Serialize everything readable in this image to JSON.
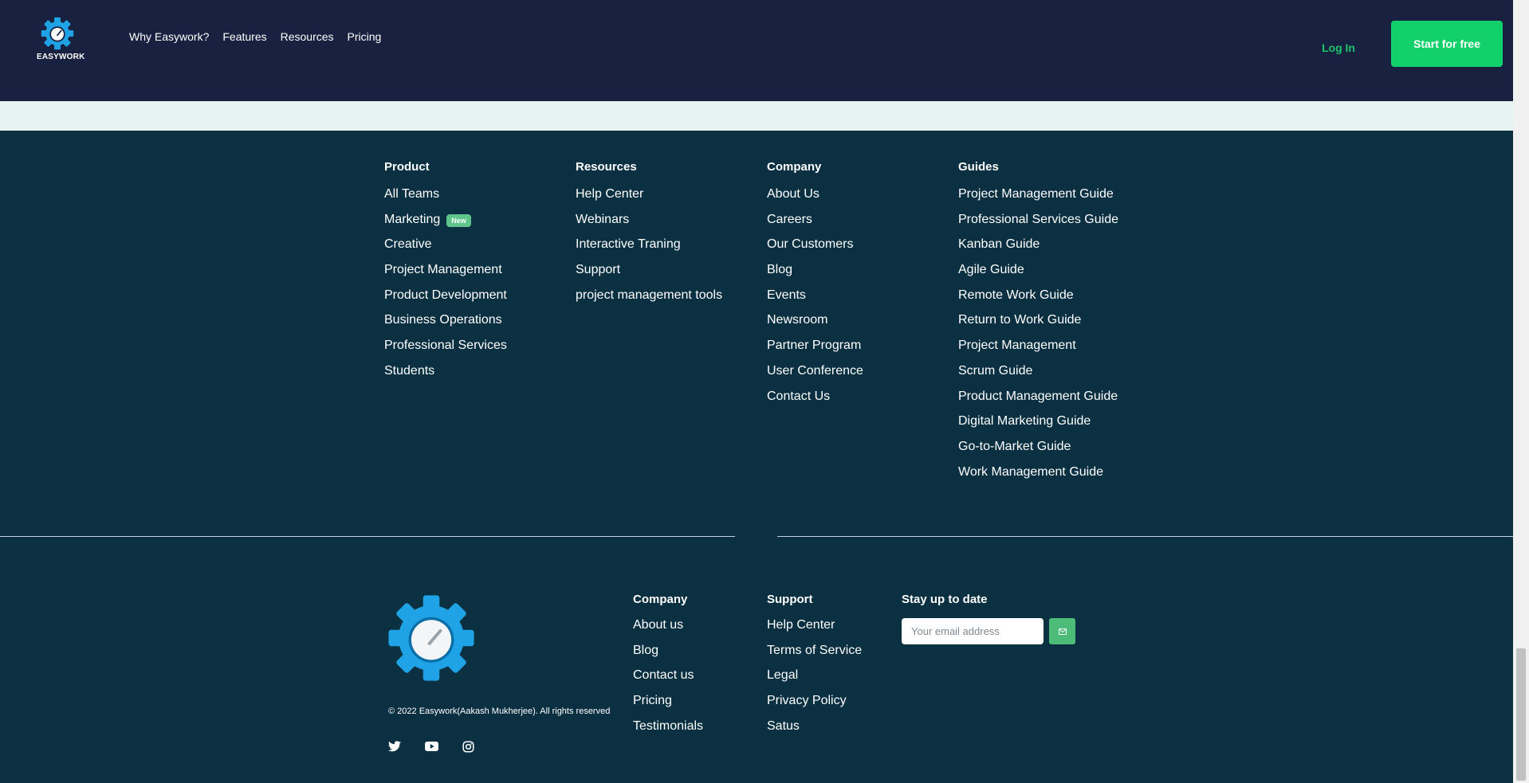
{
  "nav": {
    "brand": "EASYWORK",
    "links": [
      "Why Easywork?",
      "Features",
      "Resources",
      "Pricing"
    ],
    "login": "Log In",
    "cta": "Start for free"
  },
  "footer": {
    "columns": [
      {
        "heading": "Product",
        "items": [
          "All Teams",
          "Marketing",
          "Creative",
          "Project Management",
          "Product Development",
          "Business Operations",
          "Professional Services",
          "Students"
        ],
        "badge": "New"
      },
      {
        "heading": "Resources",
        "items": [
          "Help Center",
          "Webinars",
          "Interactive Traning",
          "Support",
          "project management tools"
        ]
      },
      {
        "heading": "Company",
        "items": [
          "About Us",
          "Careers",
          "Our Customers",
          "Blog",
          "Events",
          "Newsroom",
          "Partner Program",
          "User Conference",
          "Contact Us"
        ]
      },
      {
        "heading": "Guides",
        "items": [
          "Project Management Guide",
          "Professional Services Guide",
          "Kanban Guide",
          "Agile Guide",
          "Remote Work Guide",
          "Return to Work Guide",
          "Project Management",
          "Scrum Guide",
          "Product Management Guide",
          "Digital Marketing Guide",
          "Go-to-Market Guide",
          "Work Management Guide"
        ]
      }
    ],
    "bottom": {
      "copyright": "© 2022 Easywork(Aakash Mukherjee). All rights reserved",
      "company": {
        "heading": "Company",
        "items": [
          "About us",
          "Blog",
          "Contact us",
          "Pricing",
          "Testimonials"
        ]
      },
      "support": {
        "heading": "Support",
        "items": [
          "Help Center",
          "Terms of Service",
          "Legal",
          "Privacy Policy",
          "Satus"
        ]
      },
      "subscribe": {
        "heading": "Stay up to date",
        "placeholder": "Your email address"
      },
      "socials": [
        "twitter-icon",
        "youtube-icon",
        "instagram-icon"
      ]
    }
  },
  "colors": {
    "nav_bg": "#18213f",
    "footer_bg": "#0a3042",
    "accent_green": "#12d16b",
    "logo_blue": "#1fa3e6"
  }
}
